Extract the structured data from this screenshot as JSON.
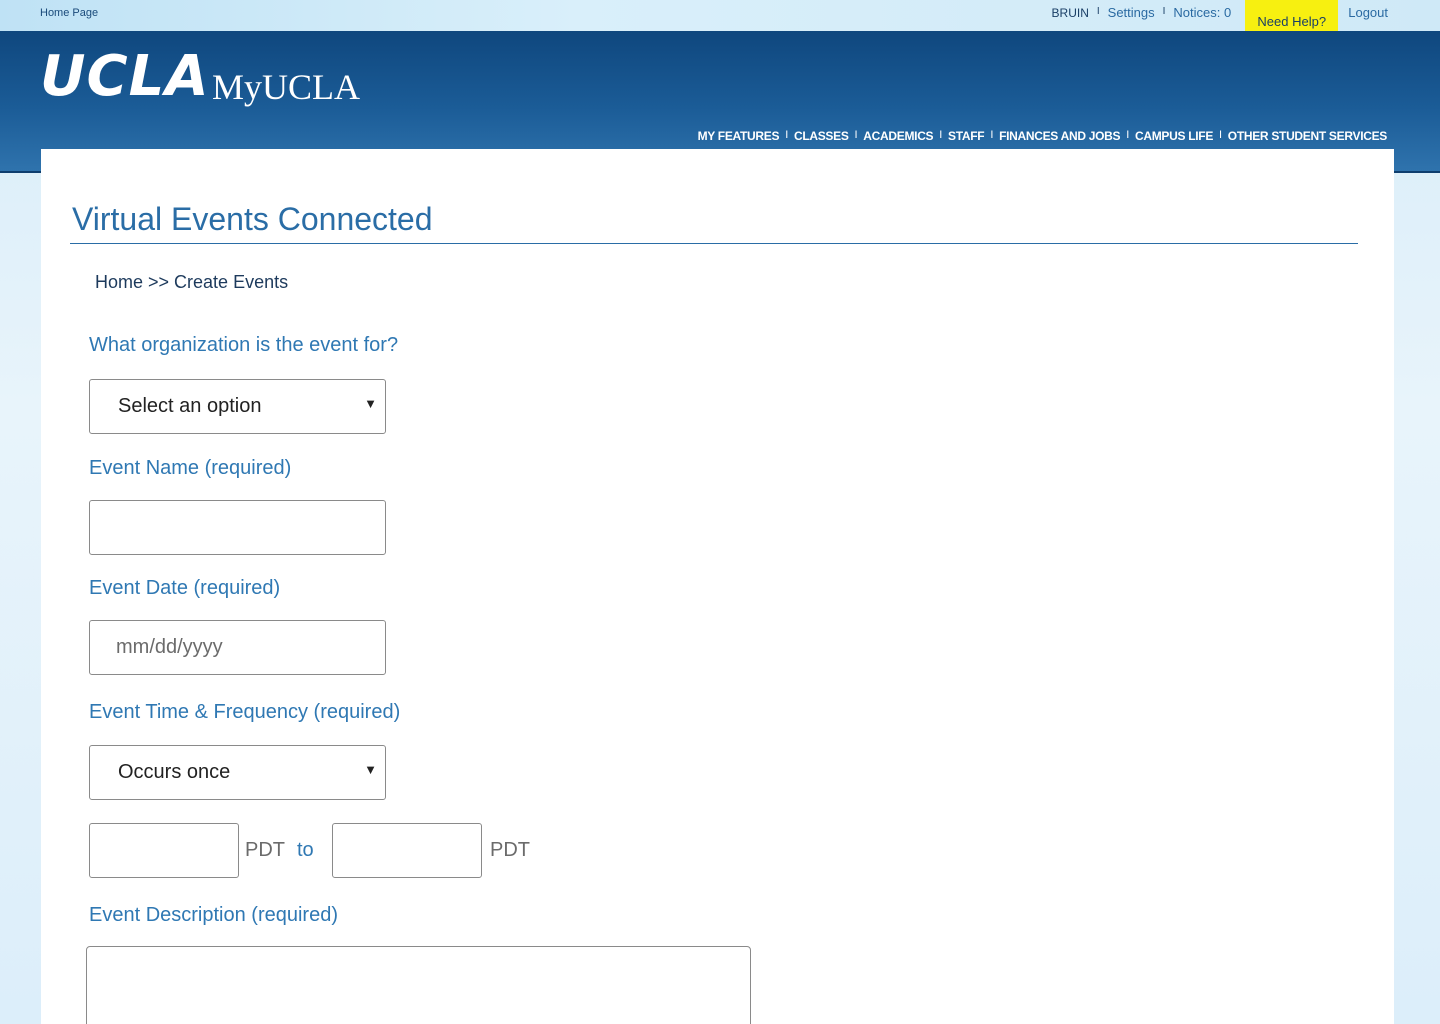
{
  "utility_bar": {
    "home_link": "Home Page",
    "user": "BRUIN",
    "sep": "I",
    "settings": "Settings",
    "notices": "Notices: 0",
    "need_help": "Need Help?",
    "logout": "Logout"
  },
  "header": {
    "logo": "UCLA",
    "product": "MyUCLA",
    "nav": [
      "MY FEATURES",
      "CLASSES",
      "ACADEMICS",
      "STAFF",
      "FINANCES AND JOBS",
      "CAMPUS LIFE",
      "OTHER STUDENT SERVICES"
    ],
    "nav_sep": "I"
  },
  "page": {
    "title": "Virtual Events Connected",
    "breadcrumb": "Home >> Create Events"
  },
  "form": {
    "organization": {
      "label": "What organization is the event for?",
      "selected": "Select an option"
    },
    "event_name": {
      "label": "Event Name (required)",
      "value": ""
    },
    "event_date": {
      "label": "Event Date (required)",
      "placeholder": "mm/dd/yyyy"
    },
    "event_time": {
      "label": "Event Time & Frequency (required)",
      "frequency_selected": "Occurs once",
      "start_time": "",
      "start_tz": "PDT",
      "to": "to",
      "end_time": "",
      "end_tz": "PDT"
    },
    "event_description": {
      "label": "Event Description (required)",
      "value": ""
    }
  },
  "colors": {
    "brand_blue": "#1b5c97",
    "help_highlight": "#f7f010",
    "label_blue": "#2f78b3"
  }
}
